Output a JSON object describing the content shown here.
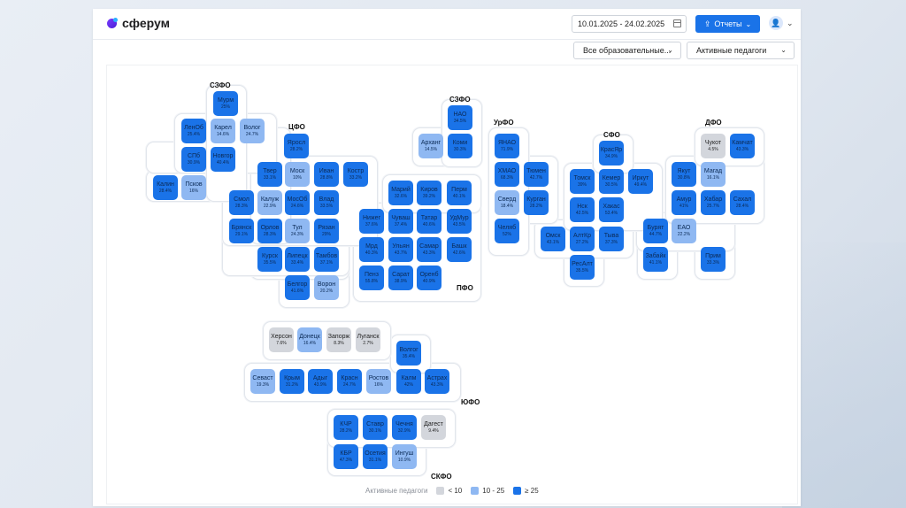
{
  "brand": {
    "name": "сферум"
  },
  "header": {
    "date_range": "10.01.2025 - 24.02.2025",
    "reports_label": "Отчеты"
  },
  "filters": {
    "org_select": "Все образовательные...",
    "metric_select": "Активные педагоги"
  },
  "colors": {
    "high": "#1a73e8",
    "mid": "#8fb8f2",
    "low": "#d3d6dc"
  },
  "legend": {
    "title": "Активные педагоги",
    "items": [
      {
        "label": "< 10",
        "level": "low"
      },
      {
        "label": "10 - 25",
        "level": "mid"
      },
      {
        "label": "≥ 25",
        "level": "high"
      }
    ]
  },
  "districts": [
    {
      "label": "СЗФО"
    },
    {
      "label": "ЦФО"
    },
    {
      "label": "СЗФО"
    },
    {
      "label": "УрФО"
    },
    {
      "label": "СФО"
    },
    {
      "label": "ДФО"
    },
    {
      "label": "ПФО"
    },
    {
      "label": "ЮФО"
    },
    {
      "label": "СКФО"
    }
  ],
  "regions": [
    {
      "name": "Мурм",
      "value": "25%",
      "level": "high"
    },
    {
      "name": "ЛенОб",
      "value": "25.4%",
      "level": "high"
    },
    {
      "name": "Карел",
      "value": "14.6%",
      "level": "mid"
    },
    {
      "name": "Волог",
      "value": "24.7%",
      "level": "mid"
    },
    {
      "name": "СПб",
      "value": "30.9%",
      "level": "high"
    },
    {
      "name": "Новгор",
      "value": "40.4%",
      "level": "high"
    },
    {
      "name": "Калин",
      "value": "28.4%",
      "level": "high"
    },
    {
      "name": "Псков",
      "value": "16%",
      "level": "mid"
    },
    {
      "name": "Яросл",
      "value": "28.2%",
      "level": "high"
    },
    {
      "name": "Твер",
      "value": "33.1%",
      "level": "high"
    },
    {
      "name": "Моск",
      "value": "10%",
      "level": "mid"
    },
    {
      "name": "Иван",
      "value": "28.8%",
      "level": "high"
    },
    {
      "name": "Костр",
      "value": "33.2%",
      "level": "high"
    },
    {
      "name": "Смол",
      "value": "28.3%",
      "level": "high"
    },
    {
      "name": "Калуж",
      "value": "22.9%",
      "level": "mid"
    },
    {
      "name": "МосОб",
      "value": "24.6%",
      "level": "high"
    },
    {
      "name": "Влад",
      "value": "33.5%",
      "level": "high"
    },
    {
      "name": "Брянск",
      "value": "29.1%",
      "level": "high"
    },
    {
      "name": "Орлов",
      "value": "28.3%",
      "level": "high"
    },
    {
      "name": "Тул",
      "value": "24.3%",
      "level": "mid"
    },
    {
      "name": "Рязан",
      "value": "29%",
      "level": "high"
    },
    {
      "name": "Курск",
      "value": "35.5%",
      "level": "high"
    },
    {
      "name": "Липецк",
      "value": "33.4%",
      "level": "high"
    },
    {
      "name": "Тамбов",
      "value": "37.1%",
      "level": "high"
    },
    {
      "name": "Белгор",
      "value": "41.6%",
      "level": "high"
    },
    {
      "name": "Ворон",
      "value": "20.2%",
      "level": "mid"
    },
    {
      "name": "НАО",
      "value": "34.5%",
      "level": "high"
    },
    {
      "name": "Арханг",
      "value": "14.5%",
      "level": "mid"
    },
    {
      "name": "Коми",
      "value": "30.3%",
      "level": "high"
    },
    {
      "name": "ЯНАО",
      "value": "71.9%",
      "level": "high"
    },
    {
      "name": "ХМАО",
      "value": "68.3%",
      "level": "high"
    },
    {
      "name": "Тюмен",
      "value": "42.7%",
      "level": "high"
    },
    {
      "name": "Сверд",
      "value": "18.4%",
      "level": "mid"
    },
    {
      "name": "Курган",
      "value": "28.2%",
      "level": "high"
    },
    {
      "name": "Челяб",
      "value": "52%",
      "level": "high"
    },
    {
      "name": "КрасЯр",
      "value": "34.9%",
      "level": "high"
    },
    {
      "name": "Томск",
      "value": "39%",
      "level": "high"
    },
    {
      "name": "Кемер",
      "value": "30.5%",
      "level": "high"
    },
    {
      "name": "Иркут",
      "value": "49.4%",
      "level": "high"
    },
    {
      "name": "Нск",
      "value": "42.5%",
      "level": "high"
    },
    {
      "name": "Хакас",
      "value": "53.4%",
      "level": "high"
    },
    {
      "name": "Омск",
      "value": "43.1%",
      "level": "high"
    },
    {
      "name": "АлтКр",
      "value": "27.2%",
      "level": "high"
    },
    {
      "name": "Тыва",
      "value": "37.3%",
      "level": "high"
    },
    {
      "name": "РесАлт",
      "value": "35.5%",
      "level": "high"
    },
    {
      "name": "Чукот",
      "value": "4.5%",
      "level": "low"
    },
    {
      "name": "Камчат",
      "value": "43.3%",
      "level": "high"
    },
    {
      "name": "Якут",
      "value": "30.8%",
      "level": "high"
    },
    {
      "name": "Магад",
      "value": "16.1%",
      "level": "mid"
    },
    {
      "name": "Амур",
      "value": "41%",
      "level": "high"
    },
    {
      "name": "Хабар",
      "value": "25.7%",
      "level": "high"
    },
    {
      "name": "Сахал",
      "value": "28.4%",
      "level": "high"
    },
    {
      "name": "Бурят",
      "value": "44.7%",
      "level": "high"
    },
    {
      "name": "ЕАО",
      "value": "22.2%",
      "level": "mid"
    },
    {
      "name": "Забайк",
      "value": "41.1%",
      "level": "high"
    },
    {
      "name": "Прим",
      "value": "33.3%",
      "level": "high"
    },
    {
      "name": "Марий",
      "value": "32.6%",
      "level": "high"
    },
    {
      "name": "Киров",
      "value": "39.2%",
      "level": "high"
    },
    {
      "name": "Перм",
      "value": "40.1%",
      "level": "high"
    },
    {
      "name": "Нижег",
      "value": "37.6%",
      "level": "high"
    },
    {
      "name": "Чуваш",
      "value": "37.4%",
      "level": "high"
    },
    {
      "name": "Татар",
      "value": "40.6%",
      "level": "high"
    },
    {
      "name": "УдМур",
      "value": "43.5%",
      "level": "high"
    },
    {
      "name": "Мрд",
      "value": "40.3%",
      "level": "high"
    },
    {
      "name": "Ульян",
      "value": "43.7%",
      "level": "high"
    },
    {
      "name": "Самар",
      "value": "43.3%",
      "level": "high"
    },
    {
      "name": "Башк",
      "value": "42.6%",
      "level": "high"
    },
    {
      "name": "Пенз",
      "value": "55.8%",
      "level": "high"
    },
    {
      "name": "Сарат",
      "value": "38.9%",
      "level": "high"
    },
    {
      "name": "Оренб",
      "value": "40.9%",
      "level": "high"
    },
    {
      "name": "Херсон",
      "value": "7.6%",
      "level": "low"
    },
    {
      "name": "Донецк",
      "value": "16.4%",
      "level": "mid"
    },
    {
      "name": "Запорж",
      "value": "8.3%",
      "level": "low"
    },
    {
      "name": "Луганск",
      "value": "2.7%",
      "level": "low"
    },
    {
      "name": "Волгог",
      "value": "35.4%",
      "level": "high"
    },
    {
      "name": "Севаст",
      "value": "19.3%",
      "level": "mid"
    },
    {
      "name": "Крым",
      "value": "31.2%",
      "level": "high"
    },
    {
      "name": "Адыг",
      "value": "43.9%",
      "level": "high"
    },
    {
      "name": "Красн",
      "value": "24.7%",
      "level": "high"
    },
    {
      "name": "Ростов",
      "value": "16%",
      "level": "mid"
    },
    {
      "name": "Калм",
      "value": "42%",
      "level": "high"
    },
    {
      "name": "Астрах",
      "value": "43.3%",
      "level": "high"
    },
    {
      "name": "КЧР",
      "value": "28.2%",
      "level": "high"
    },
    {
      "name": "Ставр",
      "value": "30.1%",
      "level": "high"
    },
    {
      "name": "Чечня",
      "value": "32.9%",
      "level": "high"
    },
    {
      "name": "Дагест",
      "value": "9.4%",
      "level": "low"
    },
    {
      "name": "КБР",
      "value": "47.3%",
      "level": "high"
    },
    {
      "name": "Осетия",
      "value": "31.1%",
      "level": "high"
    },
    {
      "name": "Ингуш",
      "value": "10.9%",
      "level": "mid"
    }
  ]
}
